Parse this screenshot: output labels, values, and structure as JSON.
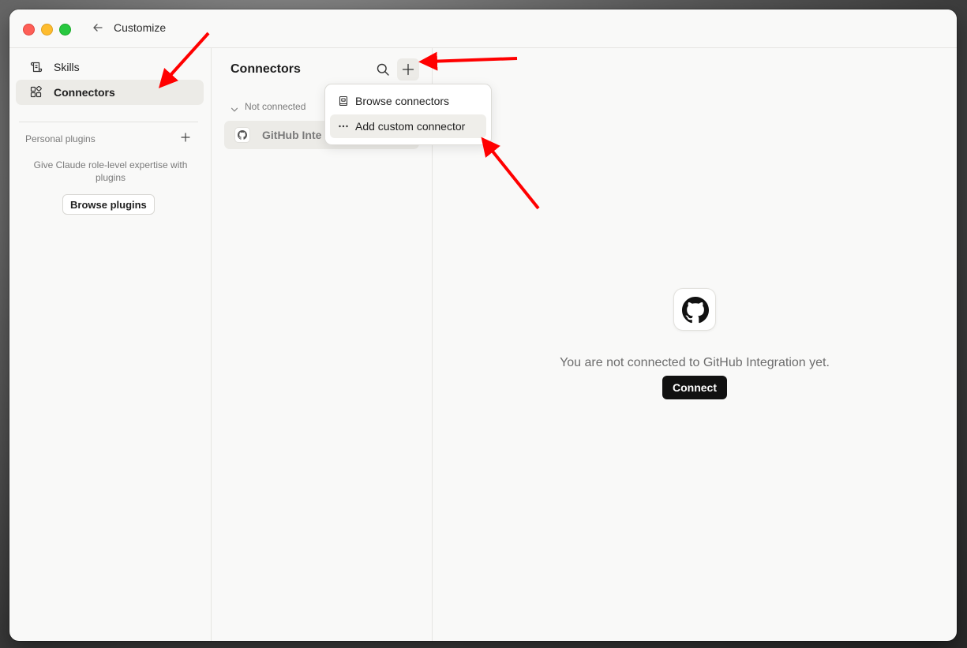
{
  "window": {
    "title": "Customize"
  },
  "sidebar": {
    "items": [
      {
        "label": "Skills",
        "icon": "skills-scroll-icon",
        "active": false
      },
      {
        "label": "Connectors",
        "icon": "connectors-blocks-icon",
        "active": true
      }
    ],
    "plugins": {
      "header": "Personal plugins",
      "description": "Give Claude role-level expertise with plugins",
      "button_label": "Browse plugins"
    }
  },
  "middle": {
    "title": "Connectors",
    "section_label": "Not connected",
    "connectors": [
      {
        "name": "GitHub Inte",
        "icon": "github-icon"
      }
    ]
  },
  "dropdown": {
    "items": [
      {
        "label": "Browse connectors",
        "icon": "book-icon"
      },
      {
        "label": "Add custom connector",
        "icon": "more-dots-icon"
      }
    ]
  },
  "detail": {
    "message": "You are not connected to GitHub Integration yet.",
    "connect_label": "Connect"
  },
  "colors": {
    "annotation_arrow": "#ff0000",
    "connect_button": "#111111"
  }
}
